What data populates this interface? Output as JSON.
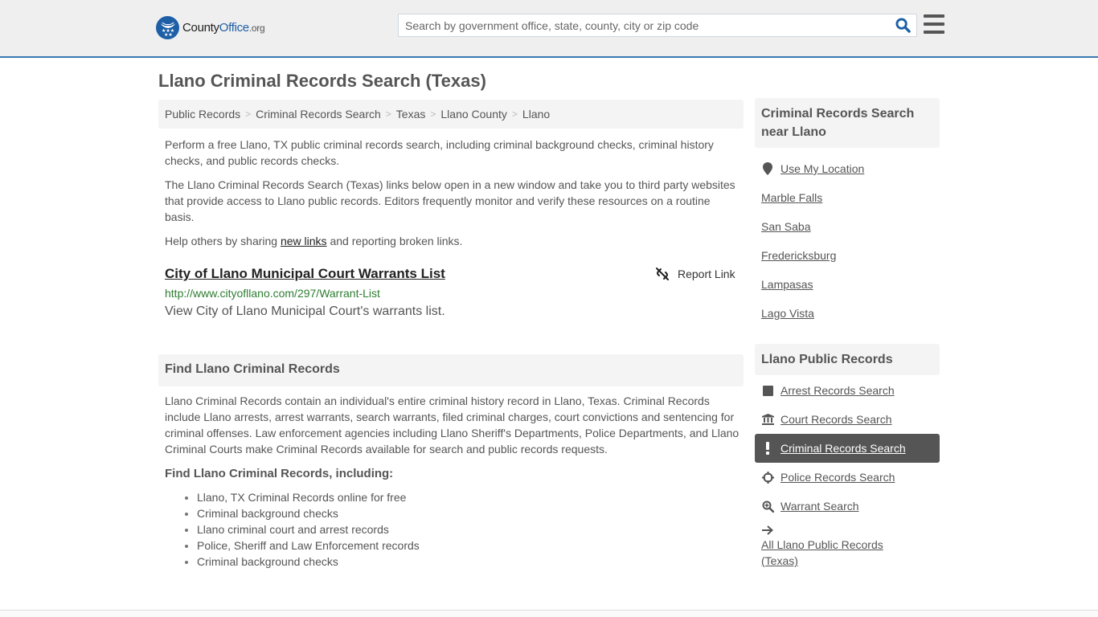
{
  "header": {
    "logo": {
      "county": "County",
      "office": "Office",
      "org": ".org"
    },
    "search_placeholder": "Search by government office, state, county, city or zip code",
    "search_value": "",
    "brand_color": "#1d5fa6",
    "accent_border": "#3a7bb0"
  },
  "page": {
    "title": "Llano Criminal Records Search (Texas)",
    "breadcrumb": [
      "Public Records",
      "Criminal Records Search",
      "Texas",
      "Llano County",
      "Llano"
    ],
    "intro": {
      "p1": "Perform a free Llano, TX public criminal records search, including criminal background checks, criminal history checks, and public records checks.",
      "p2": "The Llano Criminal Records Search (Texas) links below open in a new window and take you to third party websites that provide access to Llano public records. Editors frequently monitor and verify these resources on a routine basis.",
      "p3_before": "Help others by sharing ",
      "p3_link": "new links",
      "p3_after": " and reporting broken links."
    },
    "result": {
      "title": "City of Llano Municipal Court Warrants List",
      "url": "http://www.cityofllano.com/297/Warrant-List",
      "description": "View City of Llano Municipal Court's warrants list.",
      "report_label": "Report Link"
    },
    "find_section": {
      "heading": "Find Llano Criminal Records",
      "body": "Llano Criminal Records contain an individual's entire criminal history record in Llano, Texas. Criminal Records include Llano arrests, arrest warrants, search warrants, filed criminal charges, court convictions and sentencing for criminal offenses. Law enforcement agencies including Llano Sheriff's Departments, Police Departments, and Llano Criminal Courts make Criminal Records available for search and public records requests.",
      "subheading": "Find Llano Criminal Records, including:",
      "bullets": [
        "Llano, TX Criminal Records online for free",
        "Criminal background checks",
        "Llano criminal court and arrest records",
        "Police, Sheriff and Law Enforcement records",
        "Criminal background checks"
      ]
    }
  },
  "sidebar": {
    "nearby": {
      "heading": "Criminal Records Search near Llano",
      "use_location": "Use My Location",
      "cities": [
        "Marble Falls",
        "San Saba",
        "Fredericksburg",
        "Lampasas",
        "Lago Vista"
      ]
    },
    "public_records": {
      "heading": "Llano Public Records",
      "items": [
        {
          "label": "Arrest Records Search",
          "icon": "square-icon",
          "active": false
        },
        {
          "label": "Court Records Search",
          "icon": "courthouse-icon",
          "active": false
        },
        {
          "label": "Criminal Records Search",
          "icon": "exclamation-icon",
          "active": true
        },
        {
          "label": "Police Records Search",
          "icon": "crosshair-icon",
          "active": false
        },
        {
          "label": "Warrant Search",
          "icon": "zoom-in-icon",
          "active": false
        },
        {
          "label": "All Llano Public Records (Texas)",
          "icon": "arrow-right-icon",
          "active": false
        }
      ]
    }
  }
}
